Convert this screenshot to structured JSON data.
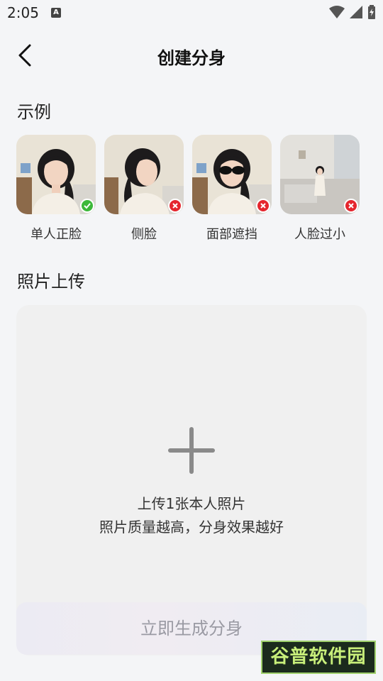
{
  "status_bar": {
    "time": "2:05",
    "notification_icon": "A"
  },
  "header": {
    "title": "创建分身"
  },
  "examples": {
    "section_title": "示例",
    "items": [
      {
        "label": "单人正脸",
        "status": "ok"
      },
      {
        "label": "侧脸",
        "status": "bad"
      },
      {
        "label": "面部遮挡",
        "status": "bad"
      },
      {
        "label": "人脸过小",
        "status": "bad"
      }
    ]
  },
  "upload": {
    "section_title": "照片上传",
    "line1": "上传1张本人照片",
    "line2": "照片质量越高，分身效果越好"
  },
  "generate_button": {
    "label": "立即生成分身"
  },
  "watermark": {
    "text": "谷普软件园"
  },
  "colors": {
    "ok_badge": "#3cb83a",
    "bad_badge": "#e5262e",
    "background": "#f4f5f7"
  }
}
